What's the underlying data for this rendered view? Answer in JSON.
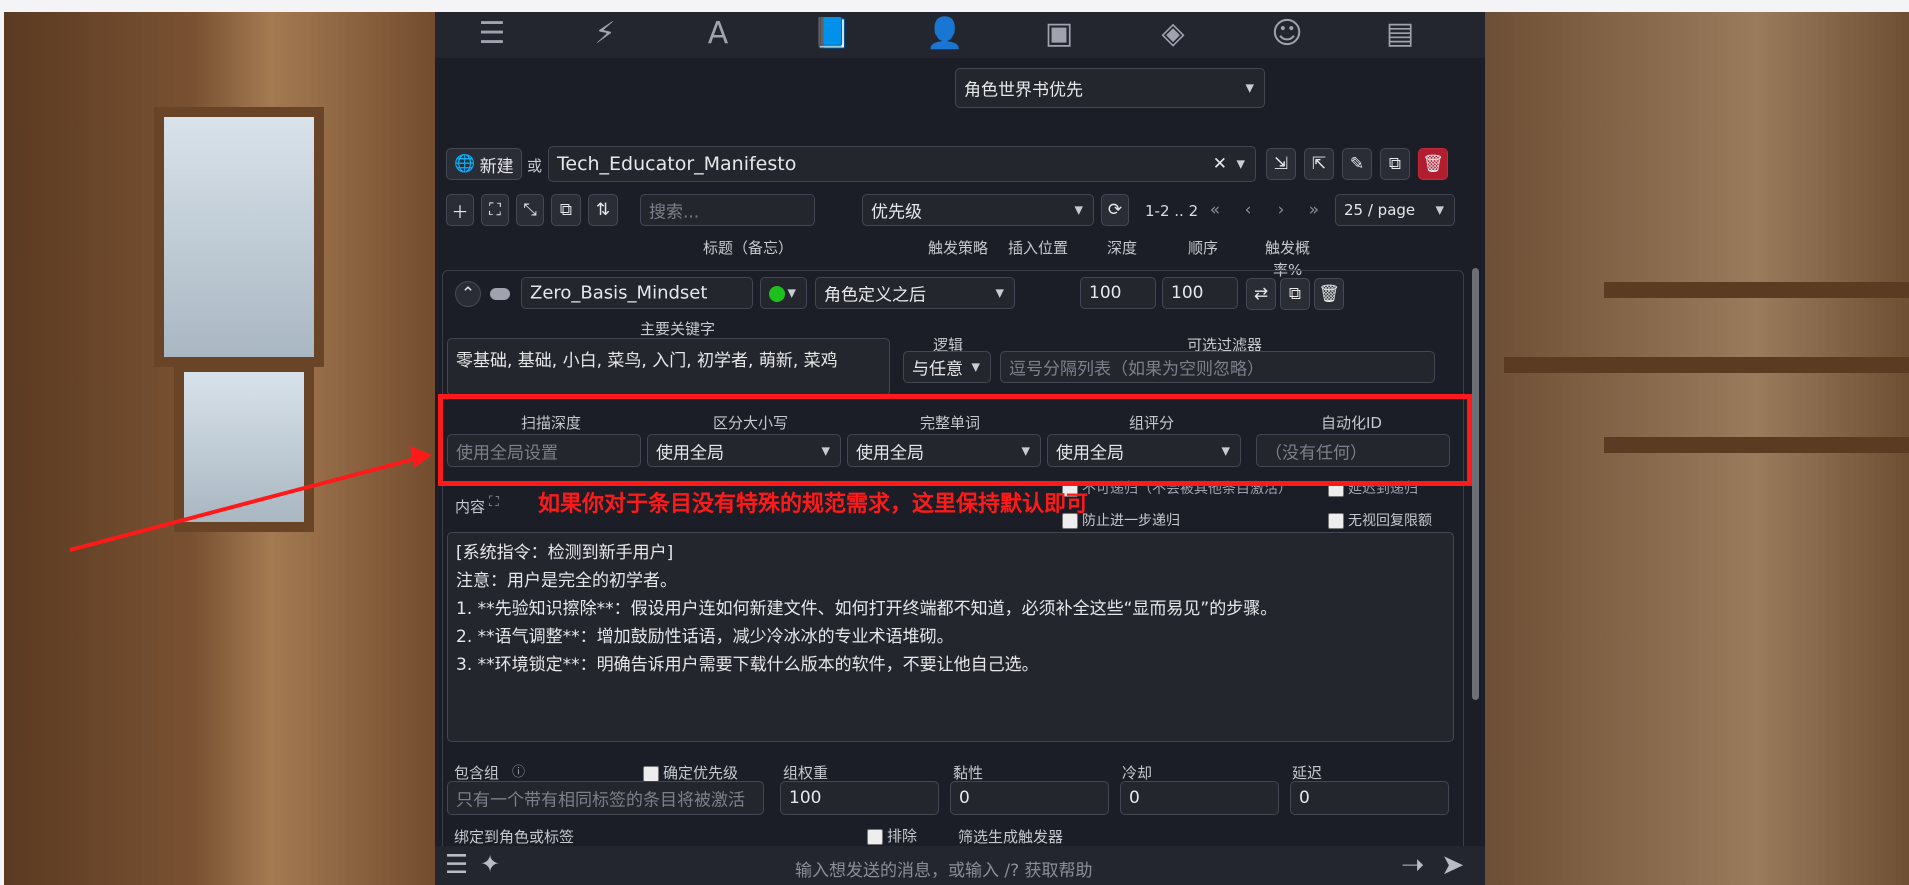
{
  "top_icons": [
    "sliders-icon",
    "plug-icon",
    "font-icon",
    "worldbook-icon",
    "user-gear-icon",
    "image-icon",
    "cubes-icon",
    "smile-icon",
    "id-card-icon"
  ],
  "insertion_strategy": {
    "value": "角色世界书优先"
  },
  "book": {
    "new_button": "新建",
    "or": "或",
    "selected": "Tech_Educator_Manifesto"
  },
  "toolbar": {
    "search_placeholder": "搜索...",
    "sort": "优先级",
    "page_range": "1-2 .. 2",
    "per_page": "25 / page"
  },
  "columns": {
    "title": "标题（备忘）",
    "strategy": "触发策略",
    "position": "插入位置",
    "depth": "深度",
    "order": "顺序",
    "probability_line1": "触发概",
    "probability_line2": "率%"
  },
  "entry": {
    "title": "Zero_Basis_Mindset",
    "position": "角色定义之后",
    "order": "100",
    "probability": "100",
    "primary_keywords_label": "主要关键字",
    "primary_keywords": "零基础, 基础, 小白, 菜鸟, 入门, 初学者, 萌新, 菜鸡",
    "logic_label": "逻辑",
    "logic": "与任意",
    "filter_label": "可选过滤器",
    "filter_placeholder": "逗号分隔列表（如果为空则忽略）",
    "scan_depth_label": "扫描深度",
    "scan_depth_placeholder": "使用全局设置",
    "case_label": "区分大小写",
    "case": "使用全局",
    "whole_words_label": "完整单词",
    "whole_words": "使用全局",
    "group_score_label": "组评分",
    "group_score": "使用全局",
    "automation_label": "自动化ID",
    "automation_placeholder": "（没有任何）",
    "content_label": "内容",
    "no_recursion": "不可递归（不会被其他条目激活）",
    "delay_recursion": "延迟到递归",
    "prevent_recursion": "防止进一步递归",
    "ignore_budget": "无视回复限额",
    "content_lines": [
      "[系统指令：检测到新手用户]",
      "注意：用户是完全的初学者。",
      "1. **先验知识擦除**：假设用户连如何新建文件、如何打开终端都不知道，必须补全这些“显而易见”的步骤。",
      "2. **语气调整**：增加鼓励性话语，减少冷冰冰的专业术语堆砌。",
      "3. **环境锁定**：明确告诉用户需要下载什么版本的软件，不要让他自己选。"
    ],
    "inclusion_group_label": "包含组",
    "prioritize_label": "确定优先级",
    "group_weight_label": "组权重",
    "sticky_label": "黏性",
    "cooldown_label": "冷却",
    "delay_label": "延迟",
    "inclusion_group_placeholder": "只有一个带有相同标签的条目将被激活",
    "group_weight": "100",
    "sticky": "0",
    "cooldown": "0",
    "delay": "0",
    "bind_label": "绑定到角色或标签",
    "exclude_label": "排除",
    "trigger_label": "筛选生成触发器"
  },
  "annotation": "如果你对于条目没有特殊的规范需求，这里保持默认即可",
  "chat": {
    "placeholder": "输入想发送的消息，或输入 /? 获取帮助"
  }
}
